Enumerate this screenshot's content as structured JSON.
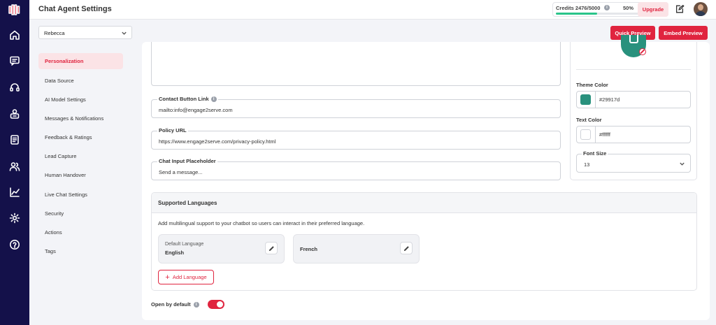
{
  "header": {
    "title": "Chat Agent Settings",
    "credits_label": "Credits 2476/5000",
    "credits_percent": "50%",
    "credits_fraction": 0.5,
    "upgrade_label": "Upgrade"
  },
  "toolbar": {
    "agent_name": "Rebecca",
    "quick_preview": "Quick Preview",
    "embed_preview": "Embed Preview"
  },
  "sidebar": {
    "items": [
      {
        "label": "Personalization",
        "active": true
      },
      {
        "label": "Data Source"
      },
      {
        "label": "AI Model Settings"
      },
      {
        "label": "Messages & Notifications"
      },
      {
        "label": "Feedback & Ratings"
      },
      {
        "label": "Lead Capture"
      },
      {
        "label": "Human Handover"
      },
      {
        "label": "Live Chat Settings"
      },
      {
        "label": "Security"
      },
      {
        "label": "Actions"
      },
      {
        "label": "Tags"
      }
    ]
  },
  "form": {
    "contact_button_link": {
      "label": "Contact Button Link",
      "value": "mailto:info@engage2serve.com"
    },
    "policy_url": {
      "label": "Policy URL",
      "value": "https://www.engage2serve.com/privacy-policy.html"
    },
    "chat_input_placeholder": {
      "label": "Chat Input Placeholder",
      "value": "Send a message..."
    }
  },
  "theme": {
    "theme_color_label": "Theme Color",
    "theme_color_value": "#29917d",
    "text_color_label": "Text Color",
    "text_color_value": "#ffffff",
    "font_size_label": "Font Size",
    "font_size_value": "13"
  },
  "languages": {
    "title": "Supported Languages",
    "description": "Add multilingual support to your chatbot so users can interact in their preferred language.",
    "default_caption": "Default Language",
    "default_value": "English",
    "second_value": "French",
    "add_label": "Add Language"
  },
  "open_by_default": {
    "label": "Open by default",
    "enabled": true
  },
  "colors": {
    "brand_red": "#e0243f",
    "rail": "#14114a",
    "theme_green": "#29917d"
  }
}
